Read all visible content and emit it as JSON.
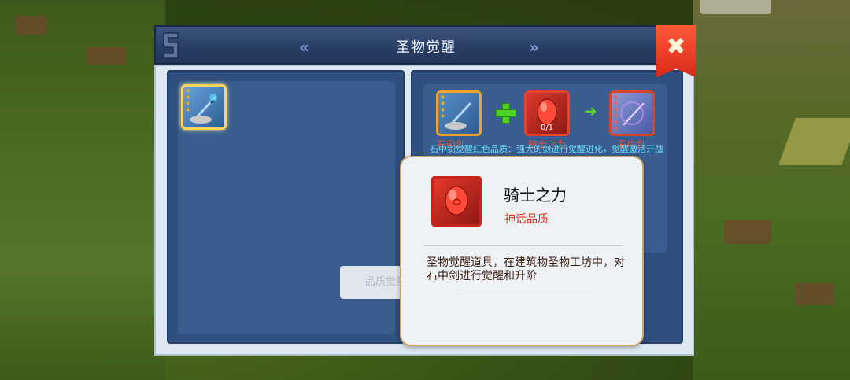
{
  "window": {
    "title": "圣物觉醒"
  },
  "nav": {
    "prev_glyph": "«",
    "next_glyph": "»"
  },
  "close": {
    "glyph": "✖"
  },
  "left_panel": {
    "relic": {
      "icon": "sword-in-stone-icon",
      "stars": 4
    }
  },
  "recipe": {
    "input_relic": {
      "label": "石中剑",
      "icon": "sword-in-stone-icon",
      "stars": 4
    },
    "material": {
      "label": "骑士之力",
      "icon": "knight-power-gem-icon",
      "count": "0/1"
    },
    "output_relic": {
      "label": "石中剑",
      "icon": "awakened-sword-icon",
      "stars": 6
    },
    "description": "石中剑觉醒红色品质：强大的剑进行觉醒进化，觉醒激活开战",
    "button_label": "品质觉醒"
  },
  "tooltip": {
    "name": "骑士之力",
    "quality": "神话品质",
    "description": "圣物觉醒道具，在建筑物圣物工坊中，对石中剑进行觉醒和升阶",
    "quality_color": "#e02a1c"
  },
  "colors": {
    "accent_gold": "#f2a32a",
    "accent_red": "#e24430",
    "title_bar": "#2a3f66"
  }
}
